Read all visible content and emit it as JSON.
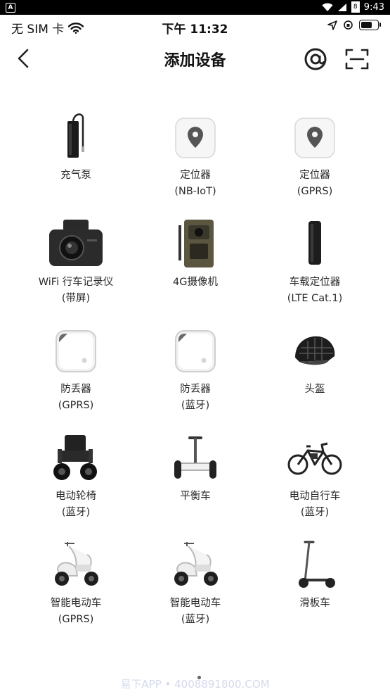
{
  "system_bar": {
    "time": "9:43",
    "battery_badge": "8"
  },
  "status_bar": {
    "carrier": "无 SIM 卡",
    "time": "下午 11:32",
    "battery_level": 0.75
  },
  "nav": {
    "title": "添加设备"
  },
  "devices": [
    {
      "name": "充气泵",
      "sub": ""
    },
    {
      "name": "定位器",
      "sub": "(NB-IoT)"
    },
    {
      "name": "定位器",
      "sub": "(GPRS)"
    },
    {
      "name": "WiFi 行车记录仪",
      "sub": "(带屏)"
    },
    {
      "name": "4G摄像机",
      "sub": ""
    },
    {
      "name": "车载定位器",
      "sub": "(LTE Cat.1)"
    },
    {
      "name": "防丢器",
      "sub": "(GPRS)"
    },
    {
      "name": "防丢器",
      "sub": "(蓝牙)"
    },
    {
      "name": "头盔",
      "sub": ""
    },
    {
      "name": "电动轮椅",
      "sub": "(蓝牙)"
    },
    {
      "name": "平衡车",
      "sub": ""
    },
    {
      "name": "电动自行车",
      "sub": "(蓝牙)"
    },
    {
      "name": "智能电动车",
      "sub": "(GPRS)"
    },
    {
      "name": "智能电动车",
      "sub": "(蓝牙)"
    },
    {
      "name": "滑板车",
      "sub": ""
    }
  ],
  "watermark": "易下APP • 4008891800.COM"
}
